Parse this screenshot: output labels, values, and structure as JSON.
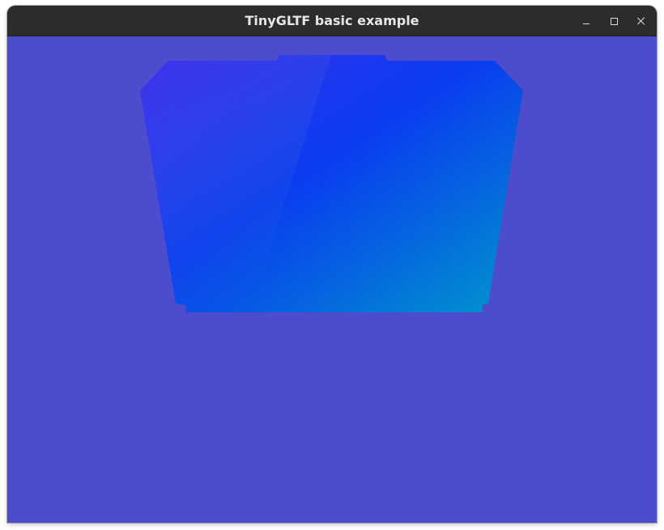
{
  "window": {
    "title": "TinyGLTF basic example",
    "controls": {
      "minimize_icon": "minimize-icon",
      "maximize_icon": "maximize-icon",
      "close_icon": "close-icon"
    }
  },
  "scene": {
    "clear_color": "#4c4ccc",
    "model_colors": {
      "top_left": "#3f30ee",
      "top_right": "#0030f0",
      "bottom_left": "#3c8cd4",
      "bottom_right": "#0090d0"
    }
  }
}
